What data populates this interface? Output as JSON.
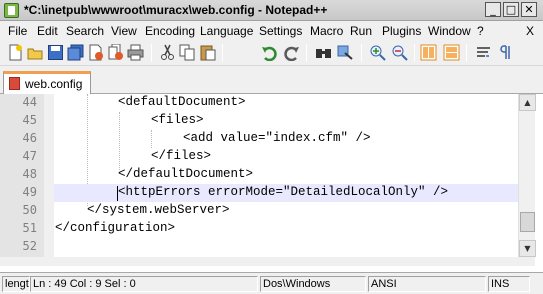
{
  "window": {
    "title": "*C:\\inetpub\\wwwroot\\muracx\\web.config - Notepad++",
    "buttons": {
      "minimize": "_",
      "maximize": "□",
      "close": "✕"
    }
  },
  "menu": {
    "items": [
      "File",
      "Edit",
      "Search",
      "View",
      "Encoding",
      "Language",
      "Settings",
      "Macro",
      "Run",
      "Plugins",
      "Window",
      "?"
    ],
    "close_doc": "X"
  },
  "toolbar": {
    "buttons": [
      "new-file-icon",
      "open-file-icon",
      "save-icon",
      "save-all-icon",
      "close-icon",
      "close-all-icon",
      "print-icon",
      "cut-icon",
      "copy-icon",
      "paste-icon",
      "undo-icon",
      "redo-icon",
      "find-icon",
      "replace-icon",
      "zoom-in-icon",
      "zoom-out-icon",
      "sync-vertical-icon",
      "sync-horizontal-icon",
      "word-wrap-icon",
      "show-all-chars-icon"
    ]
  },
  "tabs": [
    {
      "label": "web.config",
      "active": true
    }
  ],
  "editor": {
    "current_line": 49,
    "lines": [
      {
        "num": "44",
        "text": "<defaultDocument>"
      },
      {
        "num": "45",
        "text": "<files>"
      },
      {
        "num": "46",
        "text": "<add value=\"index.cfm\" />"
      },
      {
        "num": "47",
        "text": "</files>"
      },
      {
        "num": "48",
        "text": "</defaultDocument>"
      },
      {
        "num": "49",
        "text": "<httpErrors errorMode=\"DetailedLocalOnly\" />"
      },
      {
        "num": "50",
        "text": "</system.webServer>"
      },
      {
        "num": "51",
        "text": "</configuration>"
      },
      {
        "num": "52",
        "text": ""
      }
    ]
  },
  "status": {
    "length": "lengt",
    "position": "Ln : 49    Col : 9    Sel : 0",
    "eol": "Dos\\Windows",
    "encoding": "ANSI",
    "mode": "INS"
  }
}
